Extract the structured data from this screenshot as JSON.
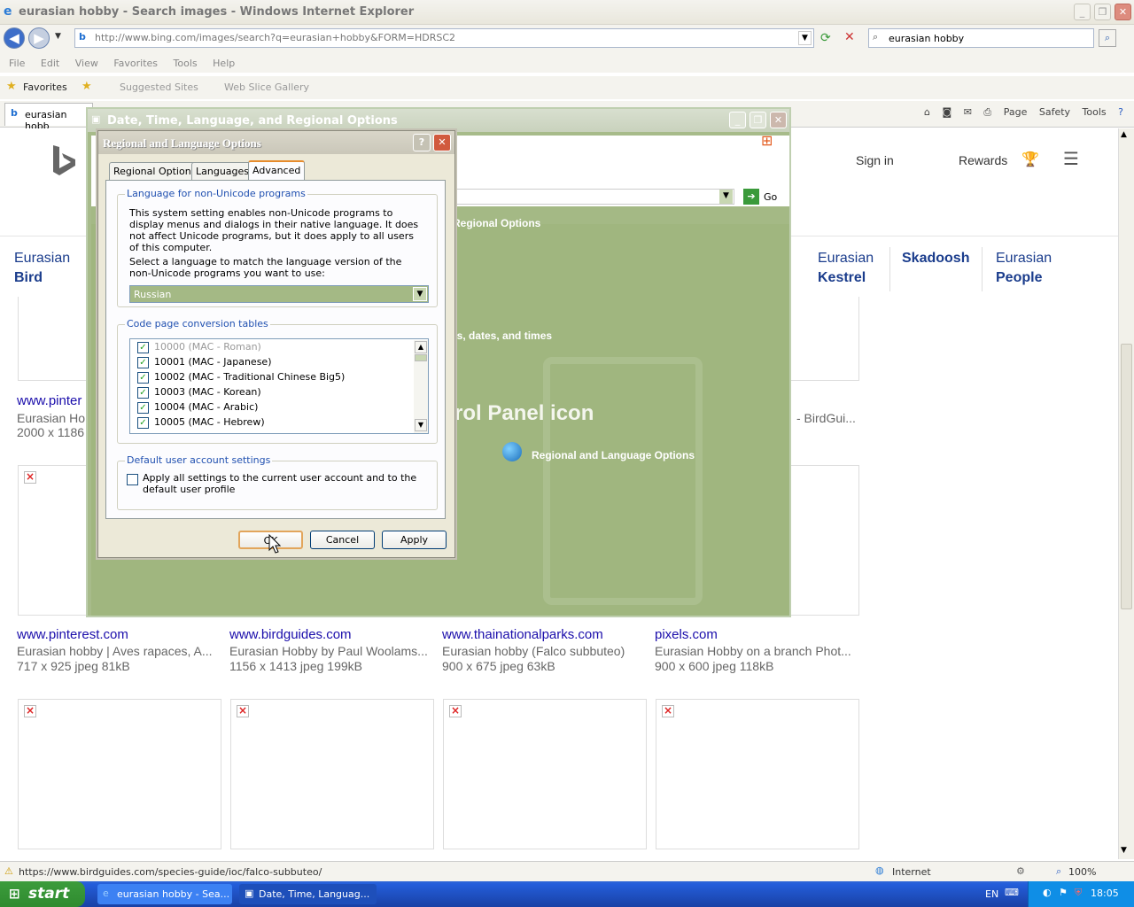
{
  "browser": {
    "title": "eurasian hobby - Search images - Windows Internet Explorer",
    "url": "http://www.bing.com/images/search?q=eurasian+hobby&FORM=HDRSC2",
    "search_value": "eurasian hobby",
    "menu": [
      "File",
      "Edit",
      "View",
      "Favorites",
      "Tools",
      "Help"
    ],
    "favorites_label": "Favorites",
    "suggested_sites": "Suggested Sites",
    "web_slice": "Web Slice Gallery",
    "tab_label": "eurasian hobb",
    "command_bar": [
      "Page",
      "Safety",
      "Tools"
    ],
    "status_url": "https://www.birdguides.com/species-guide/ioc/falco-subbuteo/",
    "zone": "Internet",
    "zoom": "100%"
  },
  "bing": {
    "sign_in": "Sign in",
    "rewards": "Rewards",
    "chips": [
      {
        "a": "Eurasian",
        "b": "Bird"
      },
      {
        "a": "Eurasian",
        "b": "Kestrel"
      },
      {
        "a": "",
        "b": "Skadoosh"
      },
      {
        "a": "Eurasian",
        "b": "People"
      }
    ],
    "row1": {
      "src": "www.pinter",
      "cap": "Eurasian Ho",
      "size": "2000 x 1186",
      "right_cap": "- BirdGui..."
    },
    "row2": [
      {
        "src": "www.pinterest.com",
        "cap": "Eurasian hobby | Aves rapaces, A...",
        "size": "717 x 925 jpeg 81kB"
      },
      {
        "src": "www.birdguides.com",
        "cap": "Eurasian Hobby by Paul Woolams...",
        "size": "1156 x 1413 jpeg 199kB"
      },
      {
        "src": "www.thainationalparks.com",
        "cap": "Eurasian hobby (Falco subbuteo)",
        "size": "900 x 675 jpeg 63kB"
      },
      {
        "src": "pixels.com",
        "cap": "Eurasian Hobby on a branch Phot...",
        "size": "900 x 600 jpeg 118kB"
      }
    ]
  },
  "control_panel": {
    "title": "Date, Time, Language, and Regional Options",
    "go": "Go",
    "breadcrumb_frag": "Regional Options",
    "task_frag": "rs, dates, and times",
    "icon_heading": "rol Panel icon",
    "icon_link": "Regional and Language Options"
  },
  "dialog": {
    "title": "Regional and Language Options",
    "help": "?",
    "tabs": [
      "Regional Options",
      "Languages",
      "Advanced"
    ],
    "group1_legend": "Language for non-Unicode programs",
    "group1_text": "This system setting enables non-Unicode programs to display menus and dialogs in their native language. It does not affect Unicode programs, but it does apply to all users of this computer.",
    "group1_text2": "Select a language to match the language version of the non-Unicode programs you want to use:",
    "language": "Russian",
    "group2_legend": "Code page conversion tables",
    "codepages": [
      {
        "label": "10000 (MAC - Roman)",
        "checked": true,
        "dim": true
      },
      {
        "label": "10001 (MAC - Japanese)",
        "checked": true
      },
      {
        "label": "10002 (MAC - Traditional Chinese Big5)",
        "checked": true
      },
      {
        "label": "10003 (MAC - Korean)",
        "checked": true
      },
      {
        "label": "10004 (MAC - Arabic)",
        "checked": true
      },
      {
        "label": "10005 (MAC - Hebrew)",
        "checked": true
      }
    ],
    "group3_legend": "Default user account settings",
    "apply_all": "Apply all settings to the current user account and to the default user profile",
    "ok": "OK",
    "cancel": "Cancel",
    "apply": "Apply"
  },
  "taskbar": {
    "start": "start",
    "items": [
      "eurasian hobby - Sea...",
      "Date, Time, Languag..."
    ],
    "lang": "EN",
    "clock": "18:05"
  }
}
